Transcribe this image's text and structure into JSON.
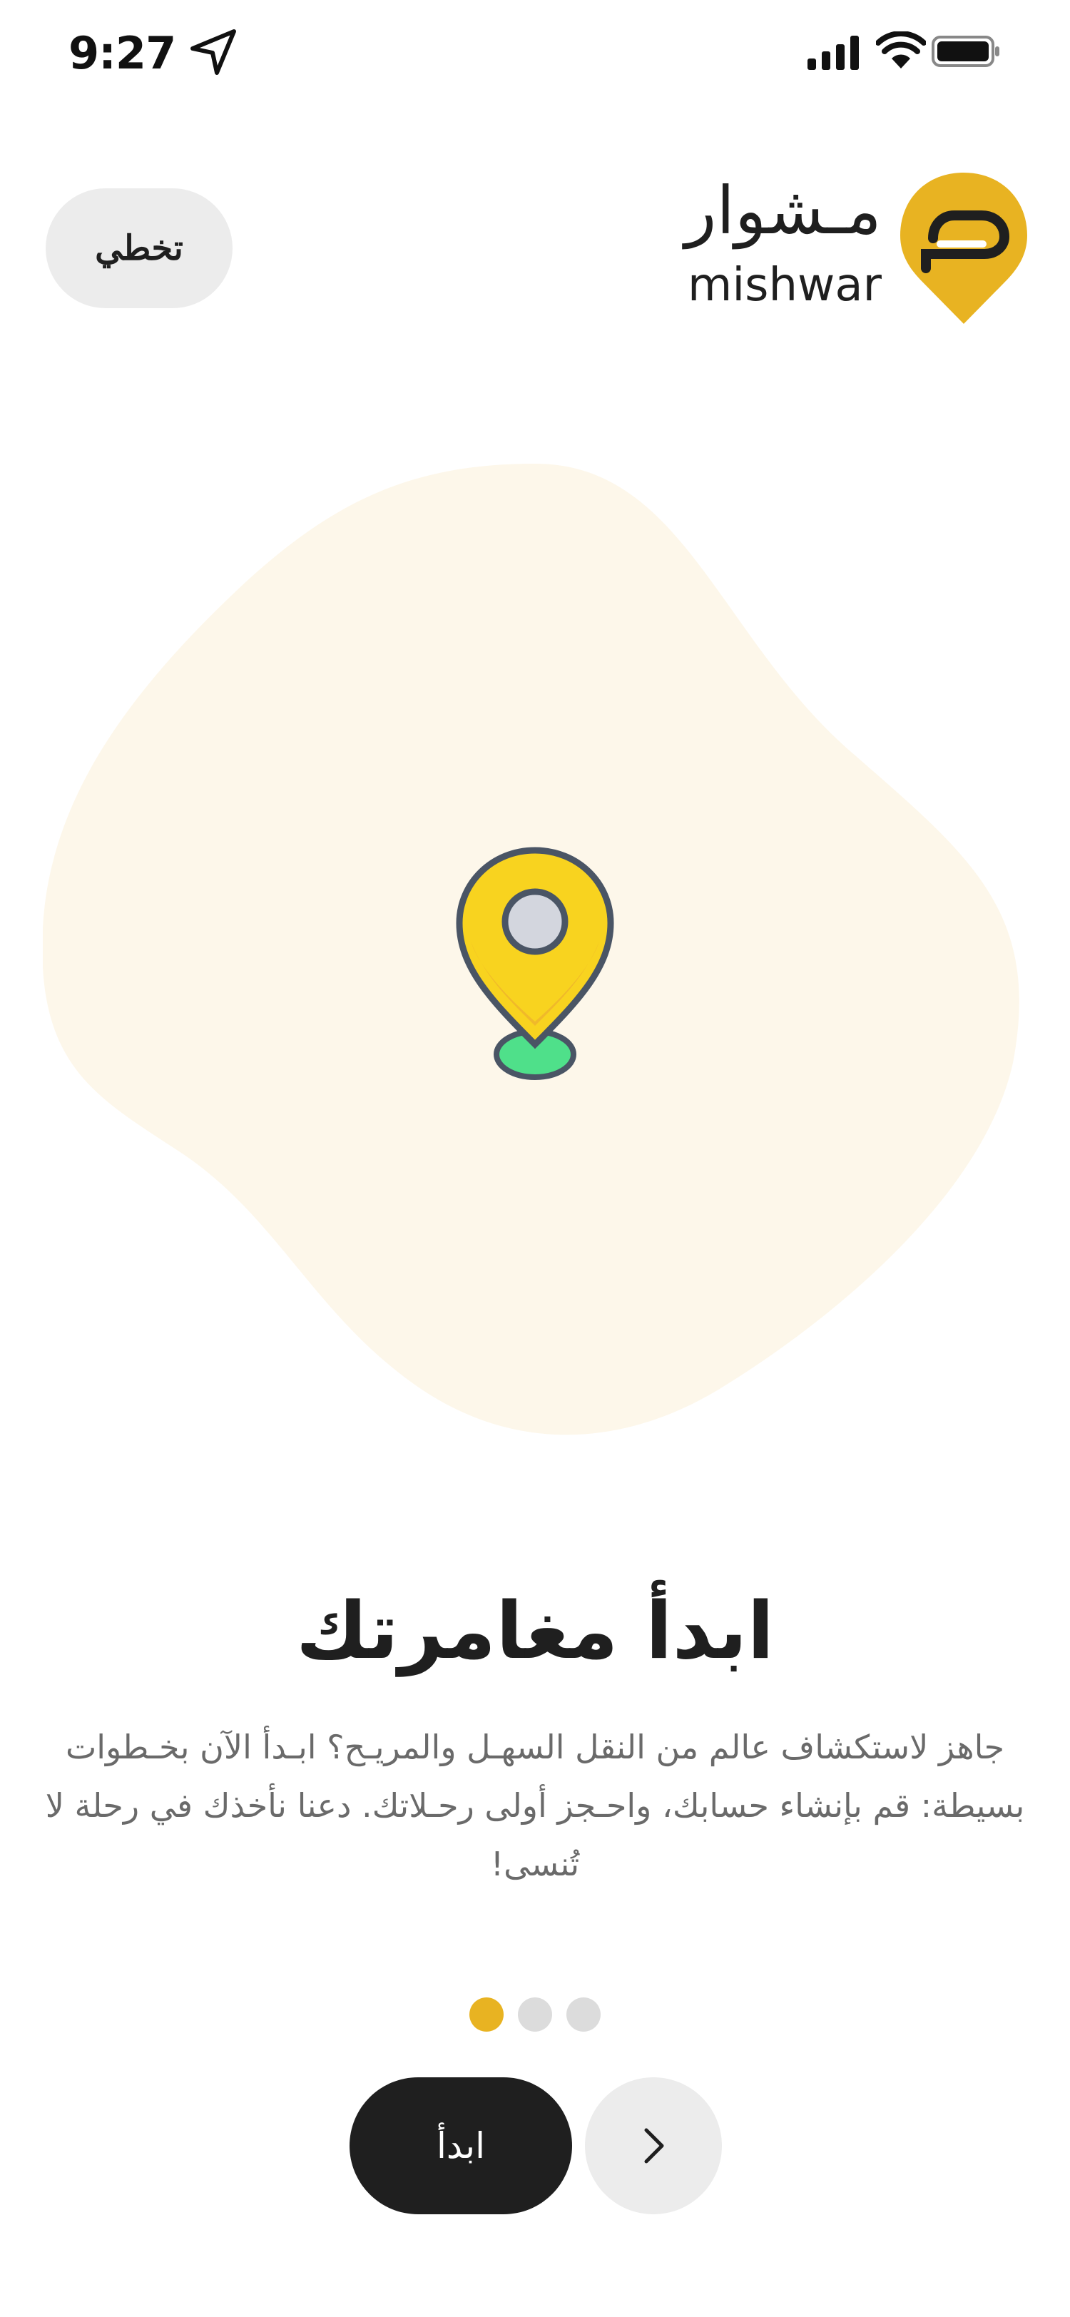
{
  "status_bar": {
    "time": "9:27",
    "location_icon": "location-arrow-icon",
    "signal_icon": "cellular-signal-icon",
    "wifi_icon": "wifi-icon",
    "battery_icon": "battery-icon"
  },
  "header": {
    "skip_label": "تخطي",
    "brand_name_ar": "مـشوار",
    "brand_name_en": "mishwar",
    "logo_icon": "mishwar-pin-logo-icon"
  },
  "illustration": {
    "icon": "map-pin-icon"
  },
  "onboarding": {
    "title": "ابدأ مغامرتك",
    "description": "جاهز لاستكشاف عالم من النقل السهـل والمريـح؟ ابـدأ الآن بخـطوات بسيطة: قم بإنشاء حسابك، واحـجز أولى رحـلاتك. دعنا نأخذك في رحلة لا تُنسى!"
  },
  "pagination": {
    "total": 3,
    "active_index": 0
  },
  "actions": {
    "start_label": "ابدأ",
    "next_icon": "chevron-right-icon"
  },
  "colors": {
    "accent": "#E8B322",
    "dark": "#1F1F1F",
    "blob": "#FDF7EA",
    "button_light": "#ECECEC",
    "pin_yellow": "#F8D31F",
    "pin_green": "#4FE08A"
  }
}
